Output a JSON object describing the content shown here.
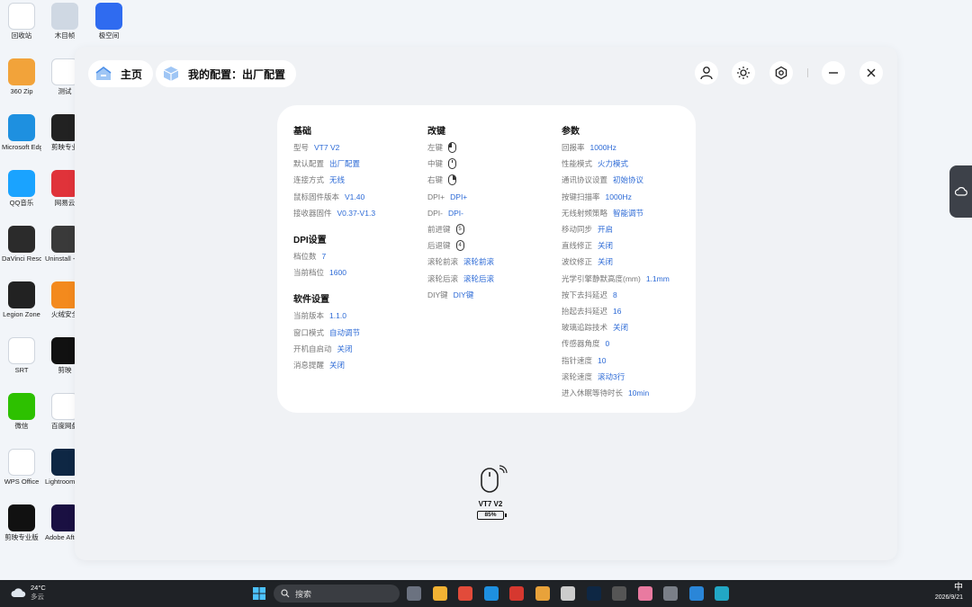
{
  "desktop": {
    "icons": [
      {
        "label": "回收站",
        "color": "#ffffff"
      },
      {
        "label": "木目帧",
        "color": "#cfd8e3"
      },
      {
        "label": "极空间",
        "color": "#2f6bf0"
      },
      {
        "label": "360 Zip",
        "color": "#f2a33a"
      },
      {
        "label": "测试",
        "color": "#ffffff"
      },
      {
        "label": "Microsoft Edge",
        "color": "#1e90e0"
      },
      {
        "label": "剪映专业",
        "color": "#222222"
      },
      {
        "label": "QQ音乐",
        "color": "#1aa3ff"
      },
      {
        "label": "网易云",
        "color": "#e0333a"
      },
      {
        "label": "DaVinci Resolve",
        "color": "#2b2b2b"
      },
      {
        "label": "Uninstall - 极空间",
        "color": "#3a3a3a"
      },
      {
        "label": "Legion Zone",
        "color": "#222222"
      },
      {
        "label": "火绒安全",
        "color": "#f38a1d"
      },
      {
        "label": "SRT",
        "color": "#ffffff"
      },
      {
        "label": "剪映",
        "color": "#111111"
      },
      {
        "label": "微信",
        "color": "#2dc100"
      },
      {
        "label": "百度网盘",
        "color": "#ffffff"
      },
      {
        "label": "WPS Office",
        "color": "#ffffff"
      },
      {
        "label": "Lightroom 极空间",
        "color": "#0e2744"
      },
      {
        "label": "剪映专业版",
        "color": "#111111"
      },
      {
        "label": "Adobe After Effects 2",
        "color": "#1a1042"
      }
    ]
  },
  "window": {
    "home_label": "主页",
    "config_label": "我的配置：出厂配置",
    "icons": [
      "user-icon",
      "brightness-icon",
      "settings-icon",
      "minimize-icon",
      "close-icon"
    ]
  },
  "basic": {
    "title": "基础",
    "rows": [
      {
        "k": "型号",
        "v": "VT7 V2"
      },
      {
        "k": "默认配置",
        "v": "出厂配置"
      },
      {
        "k": "连接方式",
        "v": "无线"
      },
      {
        "k": "鼠标固件版本",
        "v": "V1.40"
      },
      {
        "k": "接收器固件",
        "v": "V0.37-V1.3"
      }
    ]
  },
  "dpi": {
    "title": "DPI设置",
    "rows": [
      {
        "k": "档位数",
        "v": "7"
      },
      {
        "k": "当前档位",
        "v": "1600"
      }
    ]
  },
  "software": {
    "title": "软件设置",
    "rows": [
      {
        "k": "当前版本",
        "v": "1.1.0"
      },
      {
        "k": "窗口模式",
        "v": "自动调节"
      },
      {
        "k": "开机自启动",
        "v": "关闭"
      },
      {
        "k": "消息提醒",
        "v": "关闭"
      }
    ]
  },
  "keys": {
    "title": "改键",
    "icon_rows": [
      {
        "k": "左键"
      },
      {
        "k": "中键"
      },
      {
        "k": "右键"
      }
    ],
    "rows_a": [
      {
        "k": "DPI+",
        "v": "DPI+"
      },
      {
        "k": "DPI-",
        "v": "DPI-"
      }
    ],
    "icon_rows_b": [
      {
        "k": "前进键",
        "glyph": "5"
      },
      {
        "k": "后退键",
        "glyph": "4"
      }
    ],
    "rows_b": [
      {
        "k": "滚轮前滚",
        "v": "滚轮前滚"
      },
      {
        "k": "滚轮后滚",
        "v": "滚轮后滚"
      },
      {
        "k": "DIY键",
        "v": "DIY键"
      }
    ]
  },
  "params": {
    "title": "参数",
    "rows": [
      {
        "k": "回报率",
        "v": "1000Hz"
      },
      {
        "k": "性能模式",
        "v": "火力模式"
      },
      {
        "k": "通讯协议设置",
        "v": "初始协议"
      },
      {
        "k": "按键扫描率",
        "v": "1000Hz"
      },
      {
        "k": "无线射频策略",
        "v": "智能调节"
      },
      {
        "k": "移动同步",
        "v": "开启"
      },
      {
        "k": "直线修正",
        "v": "关闭"
      },
      {
        "k": "波纹修正",
        "v": "关闭"
      },
      {
        "k": "光学引擎静默高度(mm)",
        "v": "1.1mm"
      },
      {
        "k": "按下去抖延迟",
        "v": "8"
      },
      {
        "k": "抬起去抖延迟",
        "v": "16"
      },
      {
        "k": "玻璃追踪技术",
        "v": "关闭"
      },
      {
        "k": "传感器角度",
        "v": "0"
      },
      {
        "k": "指针速度",
        "v": "10"
      },
      {
        "k": "滚轮速度",
        "v": "滚动3行"
      },
      {
        "k": "进入休眠等待时长",
        "v": "10min"
      }
    ]
  },
  "device": {
    "name": "VT7 V2",
    "battery": "85%"
  },
  "taskbar": {
    "temp": "24°C",
    "weather": "多云",
    "search_placeholder": "搜索",
    "ime": "中",
    "date": "2026/9/21",
    "app_colors": [
      "#6b7280",
      "#f2b233",
      "#e24b3a",
      "#1e90e0",
      "#d6382f",
      "#e8a23a",
      "#cccccc",
      "#0e2744",
      "#555555",
      "#e97aa0",
      "#7a7f88",
      "#2a86d8",
      "#22a7c5"
    ]
  }
}
